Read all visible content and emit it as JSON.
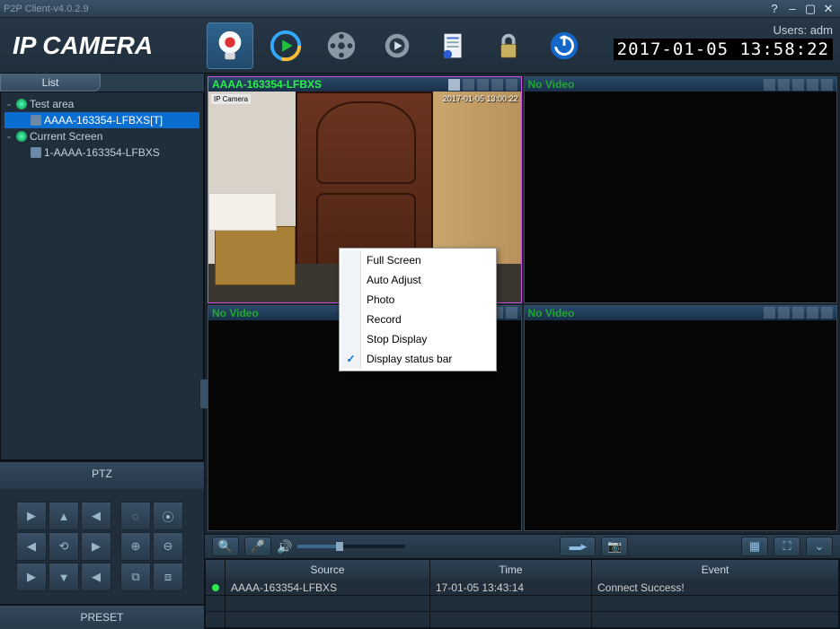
{
  "titlebar": {
    "title": "P2P Client-v4.0.2.9"
  },
  "header": {
    "logo": "IP CAMERA",
    "user_label": "Users: adm",
    "clock": "2017-01-05 13:58:22"
  },
  "left": {
    "list_tab": "List",
    "tree": {
      "test_area": "Test area",
      "cam1": "AAAA-163354-LFBXS[T]",
      "current_screen": "Current Screen",
      "cam2": "1-AAAA-163354-LFBXS"
    },
    "ptz_label": "PTZ",
    "preset_label": "PRESET"
  },
  "grid": {
    "c1": {
      "title": "AAAA-163354-LFBXS",
      "overlay_label": "IP Camera",
      "overlay_time": "2017-01-05 13:00:22"
    },
    "c2": {
      "title": "No Video"
    },
    "c3": {
      "title": "No Video"
    },
    "c4": {
      "title": "No Video"
    }
  },
  "context_menu": {
    "full_screen": "Full Screen",
    "auto_adjust": "Auto Adjust",
    "photo": "Photo",
    "record": "Record",
    "stop_display": "Stop Display",
    "display_status_bar": "Display status bar"
  },
  "log": {
    "col_source": "Source",
    "col_time": "Time",
    "col_event": "Event",
    "rows": {
      "r0_source": "AAAA-163354-LFBXS",
      "r0_time": "17-01-05 13:43:14",
      "r0_event": "Connect Success!"
    }
  }
}
